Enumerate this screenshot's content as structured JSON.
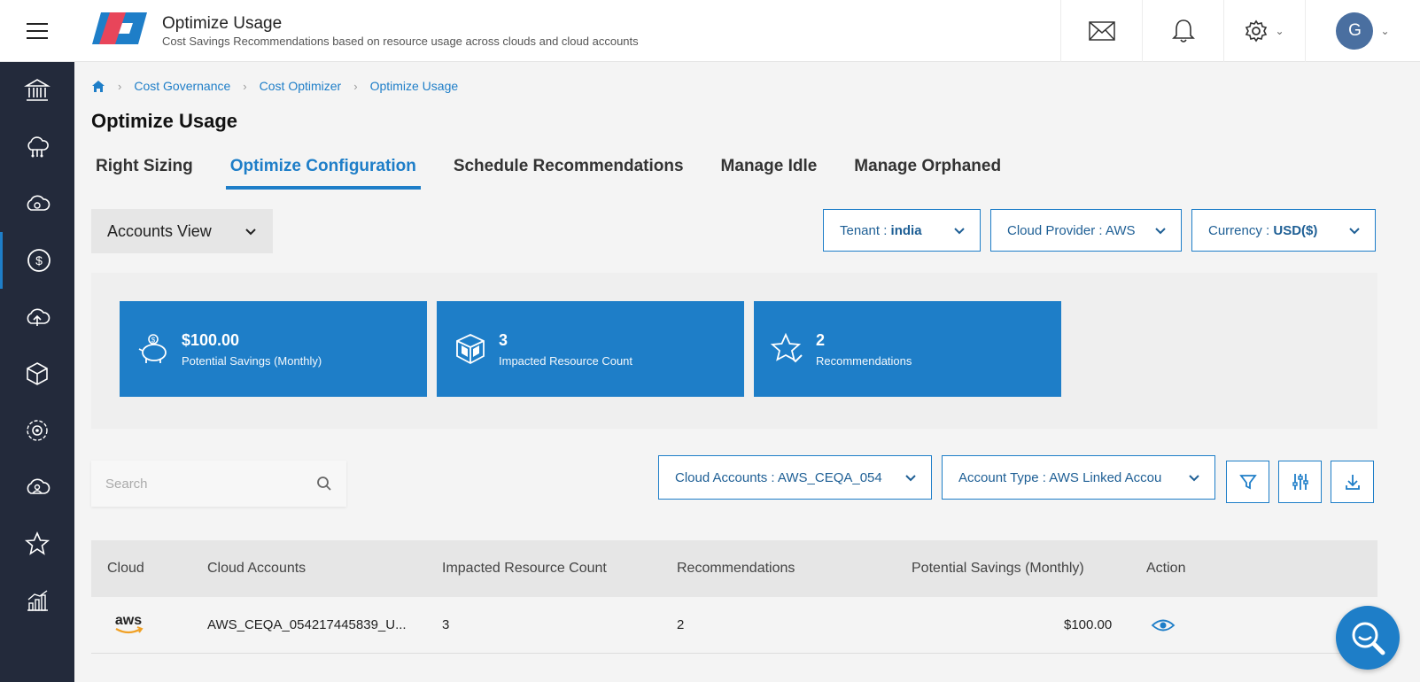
{
  "header": {
    "title": "Optimize Usage",
    "subtitle": "Cost Savings Recommendations based on resource usage across clouds and cloud accounts",
    "avatar_initial": "G"
  },
  "sidebar": {
    "items": [
      {
        "icon": "bank-icon"
      },
      {
        "icon": "cloud-network-icon"
      },
      {
        "icon": "cloud-sync-icon"
      },
      {
        "icon": "dollar-icon",
        "active": true
      },
      {
        "icon": "cloud-upload-icon"
      },
      {
        "icon": "cube-icon"
      },
      {
        "icon": "gear-cycle-icon"
      },
      {
        "icon": "cloud-user-icon"
      },
      {
        "icon": "star-icon"
      },
      {
        "icon": "analytics-icon"
      }
    ]
  },
  "breadcrumb": [
    "Cost Governance",
    "Cost Optimizer",
    "Optimize Usage"
  ],
  "page_title": "Optimize Usage",
  "tabs": [
    {
      "label": "Right Sizing"
    },
    {
      "label": "Optimize Configuration",
      "active": true
    },
    {
      "label": "Schedule Recommendations"
    },
    {
      "label": "Manage Idle"
    },
    {
      "label": "Manage Orphaned"
    }
  ],
  "view_select": {
    "value": "Accounts View"
  },
  "filters": {
    "tenant": {
      "label": "Tenant : ",
      "value": "india"
    },
    "cloud_provider": {
      "label": "Cloud Provider : AWS"
    },
    "currency": {
      "label": "Currency : ",
      "value": "USD($)"
    }
  },
  "summary": [
    {
      "value": "$100.00",
      "label": "Potential Savings (Monthly)",
      "icon": "piggy-bank-icon"
    },
    {
      "value": "3",
      "label": "Impacted Resource Count",
      "icon": "cube-icon"
    },
    {
      "value": "2",
      "label": "Recommendations",
      "icon": "star-check-icon"
    }
  ],
  "search": {
    "placeholder": "Search"
  },
  "table_filters": {
    "cloud_accounts": "Cloud Accounts : AWS_CEQA_054",
    "account_type": "Account Type : AWS Linked Accou"
  },
  "table": {
    "headers": [
      "Cloud",
      "Cloud Accounts",
      "Impacted Resource Count",
      "Recommendations",
      "Potential Savings (Monthly)",
      "Action"
    ],
    "rows": [
      {
        "cloud_logo": "aws",
        "account": "AWS_CEQA_054217445839_U...",
        "impacted": "3",
        "recommendations": "2",
        "savings": "$100.00"
      }
    ]
  },
  "colors": {
    "accent": "#1e7ec8",
    "sidebar": "#232a3b"
  }
}
